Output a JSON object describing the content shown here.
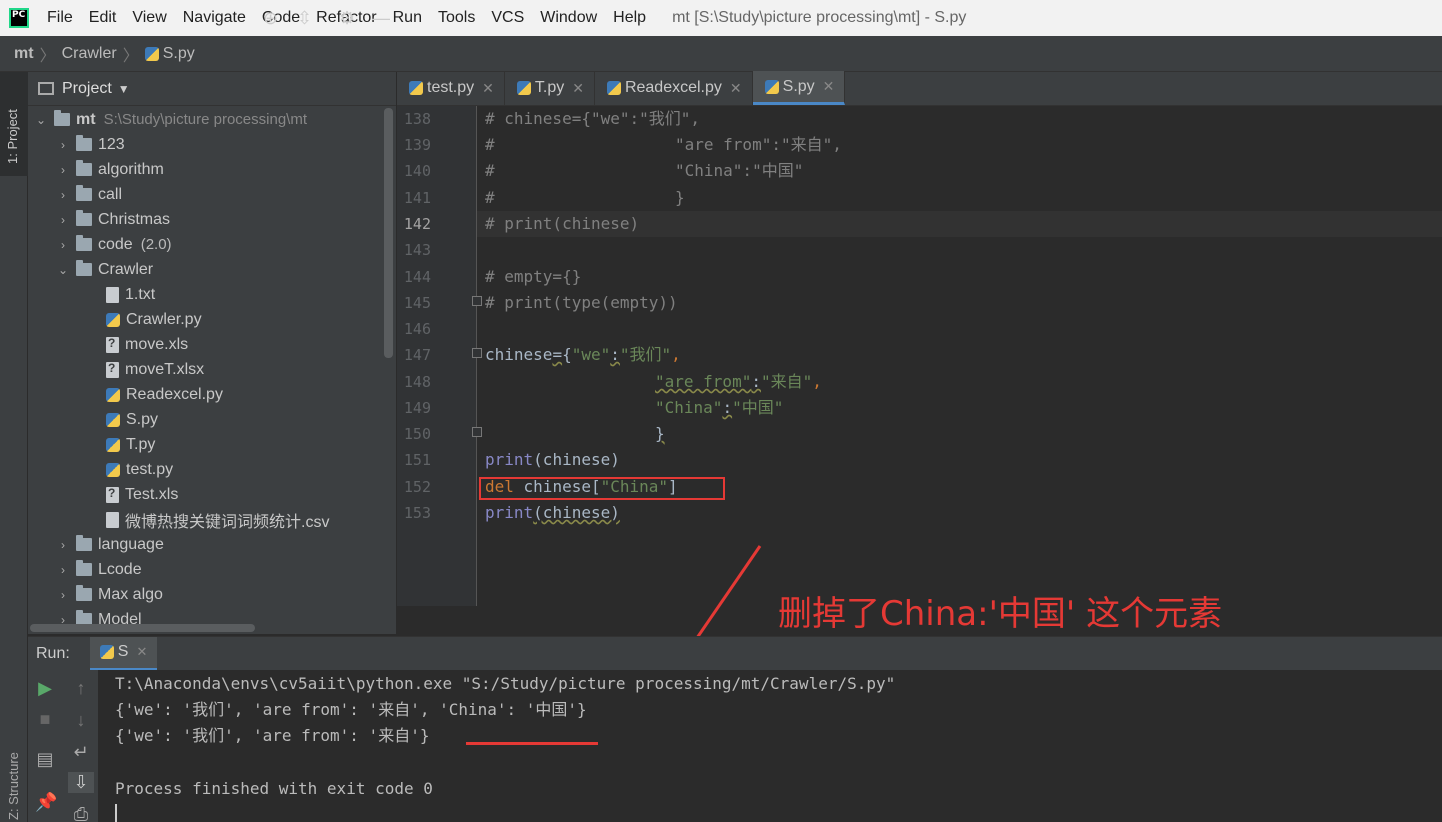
{
  "menubar": {
    "logo": "PC",
    "items": [
      "File",
      "Edit",
      "View",
      "Navigate",
      "Code",
      "Refactor",
      "Run",
      "Tools",
      "VCS",
      "Window",
      "Help"
    ],
    "window_title": "mt [S:\\Study\\picture processing\\mt] - S.py"
  },
  "breadcrumb": {
    "project": "mt",
    "folder": "Crawler",
    "file": "S.py"
  },
  "left_stripe": {
    "project": "1: Project",
    "structure": "Z: Structure"
  },
  "project_panel": {
    "title": "Project",
    "root": {
      "name": "mt",
      "path": "S:\\Study\\picture processing\\mt"
    },
    "folders_top": [
      "123",
      "algorithm",
      "call",
      "Christmas"
    ],
    "code_folder": {
      "name": "code",
      "hint": "(2.0)"
    },
    "open_folder": "Crawler",
    "files": [
      {
        "name": "1.txt",
        "type": "txt"
      },
      {
        "name": "Crawler.py",
        "type": "py"
      },
      {
        "name": "move.xls",
        "type": "unknown"
      },
      {
        "name": "moveT.xlsx",
        "type": "unknown"
      },
      {
        "name": "Readexcel.py",
        "type": "py"
      },
      {
        "name": "S.py",
        "type": "py"
      },
      {
        "name": "T.py",
        "type": "py"
      },
      {
        "name": "test.py",
        "type": "py"
      },
      {
        "name": "Test.xls",
        "type": "unknown"
      },
      {
        "name": "微博热搜关键词词频统计.csv",
        "type": "txt"
      }
    ],
    "folders_bottom": [
      "language",
      "Lcode",
      "Max algo",
      "Model"
    ]
  },
  "tabs": [
    {
      "label": "test.py",
      "active": false
    },
    {
      "label": "T.py",
      "active": false
    },
    {
      "label": "Readexcel.py",
      "active": false
    },
    {
      "label": "S.py",
      "active": true
    }
  ],
  "line_numbers": [
    "138",
    "139",
    "140",
    "141",
    "142",
    "143",
    "144",
    "145",
    "146",
    "147",
    "148",
    "149",
    "150",
    "151",
    "152",
    "153"
  ],
  "code": {
    "l138": "# chinese={\"we\":\"我们\",",
    "l139_a": "#",
    "l139_b": "\"are from\":\"来自\",",
    "l140_a": "#",
    "l140_b": "\"China\":\"中国\"",
    "l141_a": "#",
    "l141_b": "}",
    "l142": "# print(chinese)",
    "l144": "# empty={}",
    "l145": "# print(type(empty))",
    "l147_var": "chinese",
    "l147_eq": "=",
    "l147_brace": "{",
    "l147_key": "\"we\"",
    "l147_colon": ":",
    "l147_val": "\"我们\"",
    "l147_comma": ",",
    "l148_key": "\"are from\"",
    "l148_colon": ":",
    "l148_val": "\"来自\"",
    "l148_comma": ",",
    "l149_key": "\"China\"",
    "l149_colon": ":",
    "l149_val": "\"中国\"",
    "l150": "}",
    "l151_fn": "print",
    "l151_rest": "(chinese)",
    "l152_kw": "del",
    "l152_var": " chinese[",
    "l152_str": "\"China\"",
    "l152_end": "]",
    "l153_fn": "print",
    "l153_rest": "(chinese)"
  },
  "annotation": "删掉了China:'中国' 这个元素",
  "run": {
    "label": "Run:",
    "tab": "S",
    "output": [
      "T:\\Anaconda\\envs\\cv5aiit\\python.exe \"S:/Study/picture processing/mt/Crawler/S.py\"",
      "{'we': '我们', 'are from': '来自', 'China': '中国'}",
      "{'we': '我们', 'are from': '来自'}",
      "",
      "Process finished with exit code 0"
    ]
  },
  "colors": {
    "accent": "#4a88c7",
    "annotation_red": "#e53935",
    "comment": "#808080",
    "string": "#6a8759",
    "keyword": "#cc7832",
    "builtin": "#8888c6"
  }
}
